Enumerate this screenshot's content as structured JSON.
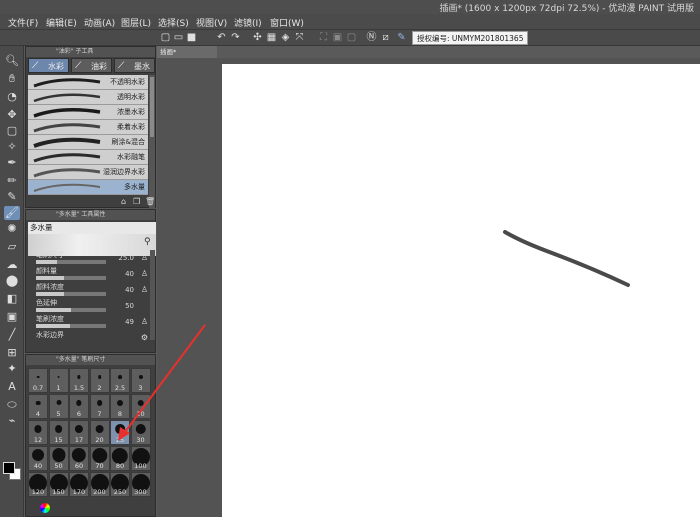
{
  "window": {
    "title": "插画* (1600 x 1200px 72dpi 72.5%) - 优动漫 PAINT 试用版"
  },
  "menu": [
    "文件(F)",
    "编辑(E)",
    "动画(A)",
    "图层(L)",
    "选择(S)",
    "视图(V)",
    "滤镜(I)",
    "窗口(W)"
  ],
  "command_bar": {
    "auth_label": "授权编号: UNMYM201801365"
  },
  "document_tab": "插画*",
  "subtool_panel": {
    "title": "\"油彩\" 子工具",
    "tabs": [
      {
        "label": "水彩",
        "icon": "brush-icon"
      },
      {
        "label": "油彩",
        "icon": "brush-icon"
      },
      {
        "label": "墨水",
        "icon": "brush-icon"
      }
    ],
    "brushes": [
      "不透明水彩",
      "透明水彩",
      "浓墨水彩",
      "柔着水彩",
      "刷涂&混合",
      "水彩融笔",
      "湿润边界水彩",
      "多水量"
    ],
    "active_brush": "多水量"
  },
  "property_panel": {
    "title": "\"多水量\" 工具属性",
    "tool_name": "多水量",
    "properties": [
      {
        "label": "笔刷尺寸",
        "value": "25.0",
        "fill": 0.3
      },
      {
        "label": "颜料量",
        "value": "40",
        "fill": 0.4
      },
      {
        "label": "颜料浓度",
        "value": "40",
        "fill": 0.4
      },
      {
        "label": "色延伸",
        "value": "50",
        "fill": 0.5
      },
      {
        "label": "笔刷浓度",
        "value": "49",
        "fill": 0.49
      },
      {
        "label": "水彩边界",
        "value": "",
        "fill": 0
      }
    ]
  },
  "brush_size_panel": {
    "title": "\"多水量\" 笔刷尺寸",
    "sizes": [
      "0.7",
      "1",
      "1.5",
      "2",
      "2.5",
      "3",
      "4",
      "5",
      "6",
      "7",
      "8",
      "10",
      "12",
      "15",
      "17",
      "20",
      "25",
      "30",
      "40",
      "50",
      "60",
      "70",
      "80",
      "100",
      "120",
      "150",
      "170",
      "200",
      "250",
      "300"
    ],
    "active_size": "25"
  },
  "colors": {
    "accent": "#6d86ac",
    "canvas": "#ffffff",
    "arrow": "#e8302c",
    "stroke": "#4a4a4a"
  }
}
